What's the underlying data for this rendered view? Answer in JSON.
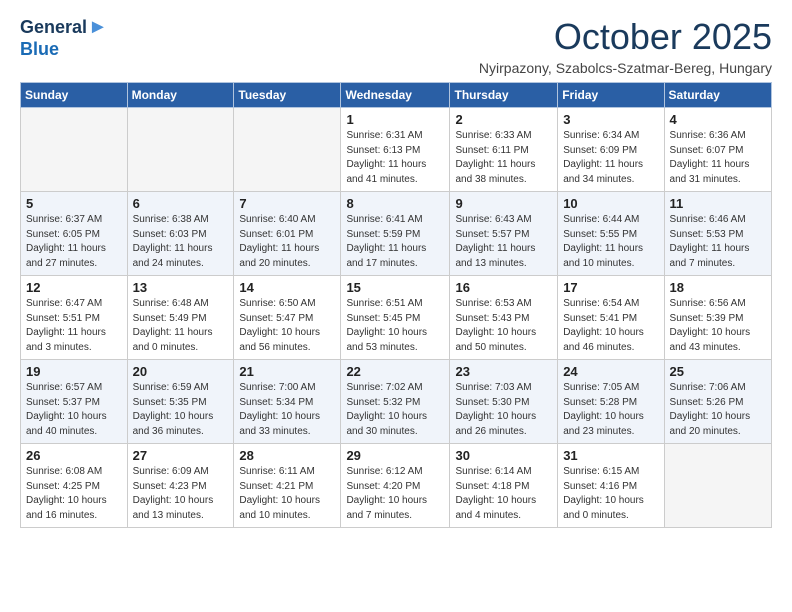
{
  "header": {
    "logo_line1": "General",
    "logo_line2": "Blue",
    "month": "October 2025",
    "location": "Nyirpazony, Szabolcs-Szatmar-Bereg, Hungary"
  },
  "weekdays": [
    "Sunday",
    "Monday",
    "Tuesday",
    "Wednesday",
    "Thursday",
    "Friday",
    "Saturday"
  ],
  "weeks": [
    [
      {
        "day": "",
        "info": ""
      },
      {
        "day": "",
        "info": ""
      },
      {
        "day": "",
        "info": ""
      },
      {
        "day": "1",
        "info": "Sunrise: 6:31 AM\nSunset: 6:13 PM\nDaylight: 11 hours and 41 minutes."
      },
      {
        "day": "2",
        "info": "Sunrise: 6:33 AM\nSunset: 6:11 PM\nDaylight: 11 hours and 38 minutes."
      },
      {
        "day": "3",
        "info": "Sunrise: 6:34 AM\nSunset: 6:09 PM\nDaylight: 11 hours and 34 minutes."
      },
      {
        "day": "4",
        "info": "Sunrise: 6:36 AM\nSunset: 6:07 PM\nDaylight: 11 hours and 31 minutes."
      }
    ],
    [
      {
        "day": "5",
        "info": "Sunrise: 6:37 AM\nSunset: 6:05 PM\nDaylight: 11 hours and 27 minutes."
      },
      {
        "day": "6",
        "info": "Sunrise: 6:38 AM\nSunset: 6:03 PM\nDaylight: 11 hours and 24 minutes."
      },
      {
        "day": "7",
        "info": "Sunrise: 6:40 AM\nSunset: 6:01 PM\nDaylight: 11 hours and 20 minutes."
      },
      {
        "day": "8",
        "info": "Sunrise: 6:41 AM\nSunset: 5:59 PM\nDaylight: 11 hours and 17 minutes."
      },
      {
        "day": "9",
        "info": "Sunrise: 6:43 AM\nSunset: 5:57 PM\nDaylight: 11 hours and 13 minutes."
      },
      {
        "day": "10",
        "info": "Sunrise: 6:44 AM\nSunset: 5:55 PM\nDaylight: 11 hours and 10 minutes."
      },
      {
        "day": "11",
        "info": "Sunrise: 6:46 AM\nSunset: 5:53 PM\nDaylight: 11 hours and 7 minutes."
      }
    ],
    [
      {
        "day": "12",
        "info": "Sunrise: 6:47 AM\nSunset: 5:51 PM\nDaylight: 11 hours and 3 minutes."
      },
      {
        "day": "13",
        "info": "Sunrise: 6:48 AM\nSunset: 5:49 PM\nDaylight: 11 hours and 0 minutes."
      },
      {
        "day": "14",
        "info": "Sunrise: 6:50 AM\nSunset: 5:47 PM\nDaylight: 10 hours and 56 minutes."
      },
      {
        "day": "15",
        "info": "Sunrise: 6:51 AM\nSunset: 5:45 PM\nDaylight: 10 hours and 53 minutes."
      },
      {
        "day": "16",
        "info": "Sunrise: 6:53 AM\nSunset: 5:43 PM\nDaylight: 10 hours and 50 minutes."
      },
      {
        "day": "17",
        "info": "Sunrise: 6:54 AM\nSunset: 5:41 PM\nDaylight: 10 hours and 46 minutes."
      },
      {
        "day": "18",
        "info": "Sunrise: 6:56 AM\nSunset: 5:39 PM\nDaylight: 10 hours and 43 minutes."
      }
    ],
    [
      {
        "day": "19",
        "info": "Sunrise: 6:57 AM\nSunset: 5:37 PM\nDaylight: 10 hours and 40 minutes."
      },
      {
        "day": "20",
        "info": "Sunrise: 6:59 AM\nSunset: 5:35 PM\nDaylight: 10 hours and 36 minutes."
      },
      {
        "day": "21",
        "info": "Sunrise: 7:00 AM\nSunset: 5:34 PM\nDaylight: 10 hours and 33 minutes."
      },
      {
        "day": "22",
        "info": "Sunrise: 7:02 AM\nSunset: 5:32 PM\nDaylight: 10 hours and 30 minutes."
      },
      {
        "day": "23",
        "info": "Sunrise: 7:03 AM\nSunset: 5:30 PM\nDaylight: 10 hours and 26 minutes."
      },
      {
        "day": "24",
        "info": "Sunrise: 7:05 AM\nSunset: 5:28 PM\nDaylight: 10 hours and 23 minutes."
      },
      {
        "day": "25",
        "info": "Sunrise: 7:06 AM\nSunset: 5:26 PM\nDaylight: 10 hours and 20 minutes."
      }
    ],
    [
      {
        "day": "26",
        "info": "Sunrise: 6:08 AM\nSunset: 4:25 PM\nDaylight: 10 hours and 16 minutes."
      },
      {
        "day": "27",
        "info": "Sunrise: 6:09 AM\nSunset: 4:23 PM\nDaylight: 10 hours and 13 minutes."
      },
      {
        "day": "28",
        "info": "Sunrise: 6:11 AM\nSunset: 4:21 PM\nDaylight: 10 hours and 10 minutes."
      },
      {
        "day": "29",
        "info": "Sunrise: 6:12 AM\nSunset: 4:20 PM\nDaylight: 10 hours and 7 minutes."
      },
      {
        "day": "30",
        "info": "Sunrise: 6:14 AM\nSunset: 4:18 PM\nDaylight: 10 hours and 4 minutes."
      },
      {
        "day": "31",
        "info": "Sunrise: 6:15 AM\nSunset: 4:16 PM\nDaylight: 10 hours and 0 minutes."
      },
      {
        "day": "",
        "info": ""
      }
    ]
  ]
}
